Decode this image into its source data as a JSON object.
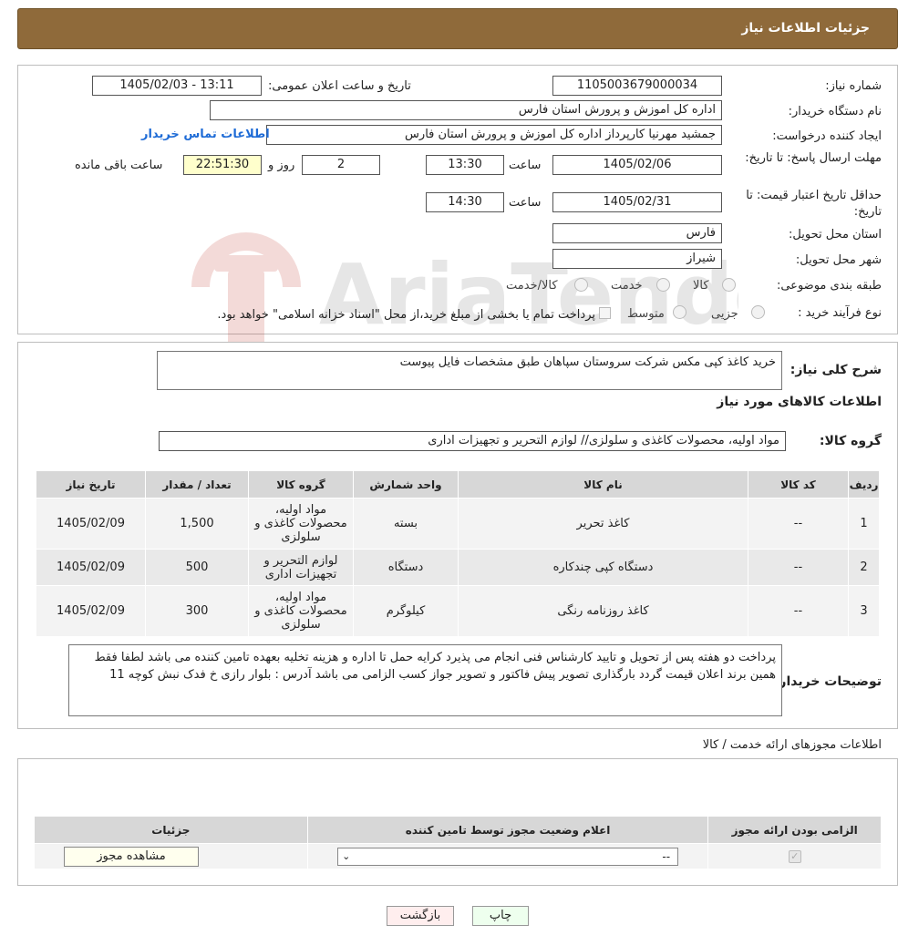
{
  "header": {
    "title": "جزئیات اطلاعات نیاز"
  },
  "form": {
    "need_number_label": "شماره نیاز:",
    "need_number": "1105003679000034",
    "announce_label": "تاریخ و ساعت اعلان عمومی:",
    "announce_value": "1405/02/03 - 13:11",
    "buyer_label": "نام دستگاه خریدار:",
    "buyer_value": "اداره کل اموزش و پرورش استان فارس",
    "creator_label": "ایجاد کننده درخواست:",
    "creator_value": "جمشید مهرنیا کارپرداز اداره کل اموزش و پرورش استان فارس",
    "contact_link": "اطلاعات تماس خریدار",
    "deadline_label": "مهلت ارسال پاسخ: تا تاریخ:",
    "deadline_date": "1405/02/06",
    "time_label": "ساعت",
    "deadline_time": "13:30",
    "days_value": "2",
    "days_label": "روز و",
    "remaining_value": "22:51:30",
    "remaining_label": "ساعت باقی مانده",
    "validity_label": "حداقل تاریخ اعتبار قیمت: تا تاریخ:",
    "validity_date": "1405/02/31",
    "validity_time": "14:30",
    "province_label": "استان محل تحویل:",
    "province_value": "فارس",
    "city_label": "شهر محل تحویل:",
    "city_value": "شیراز",
    "category_label": "طبقه بندی موضوعی:",
    "category_options": [
      "کالا",
      "خدمت",
      "کالا/خدمت"
    ],
    "process_label": "نوع فرآیند خرید :",
    "process_options": [
      "جزیی",
      "متوسط"
    ],
    "process_note": "پرداخت تمام یا بخشی از مبلغ خرید،از محل \"اسناد خزانه اسلامی\" خواهد بود."
  },
  "details": {
    "description_label": "شرح کلی نیاز:",
    "description_value": "خرید کاغذ کپی مکس شرکت سروستان سپاهان  طبق مشخصات فایل پیوست",
    "goods_info_title": "اطلاعات کالاهای مورد نیاز",
    "goods_group_label": "گروه کالا:",
    "goods_group_value": "مواد اولیه، محصولات کاغذی و سلولزی// لوازم التحریر و تجهیزات اداری",
    "table_headers": [
      "ردیف",
      "کد کالا",
      "نام کالا",
      "واحد شمارش",
      "گروه کالا",
      "تعداد / مقدار",
      "تاریخ نیاز"
    ],
    "rows": [
      {
        "row": "1",
        "code": "--",
        "name": "کاغذ تحریر",
        "unit": "بسته",
        "group": "مواد اولیه، محصولات کاغذی و سلولزی",
        "qty": "1,500",
        "date": "1405/02/09"
      },
      {
        "row": "2",
        "code": "--",
        "name": "دستگاه کپی چندکاره",
        "unit": "دستگاه",
        "group": "لوازم التحریر و تجهیزات اداری",
        "qty": "500",
        "date": "1405/02/09"
      },
      {
        "row": "3",
        "code": "--",
        "name": "کاغذ روزنامه رنگی",
        "unit": "کیلوگرم",
        "group": "مواد اولیه، محصولات کاغذی و سلولزی",
        "qty": "300",
        "date": "1405/02/09"
      }
    ],
    "buyer_notes_label": "توضیحات خریدار:",
    "buyer_notes_value": "پرداخت دو هفته پس از تحویل و تایید کارشناس فنی انجام می پذیرد کرایه حمل تا اداره و هزینه تخلیه بعهده تامین کننده می باشد لطفا فقط همین برند اعلان قیمت گردد بارگذاری تصویر پیش فاکتور و تصویر جواز کسب الزامی می باشد آدرس :  بلوار رازی خ فدک نبش کوچه 11"
  },
  "permits": {
    "title": "اطلاعات مجوزهای ارائه خدمت / کالا",
    "headers": [
      "الزامی بودن ارائه مجوز",
      "اعلام وضعیت مجوز توسط تامین کننده",
      "جزئیات"
    ],
    "select_value": "--",
    "view_button": "مشاهده مجوز"
  },
  "footer": {
    "print_button": "چاپ",
    "back_button": "بازگشت"
  },
  "watermark_text": "AriaTender.neT"
}
